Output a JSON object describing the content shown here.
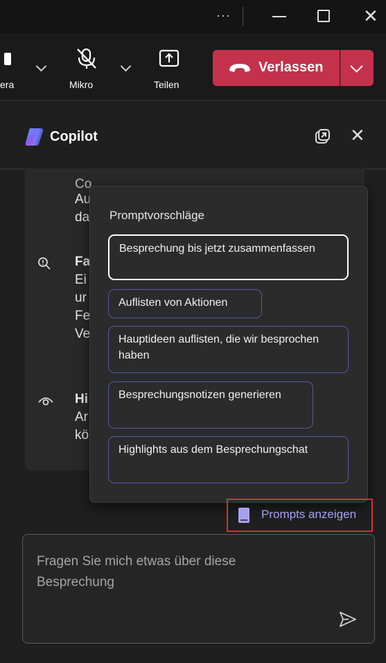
{
  "titlebar": {
    "more_glyph": "···",
    "close_glyph": "✕"
  },
  "toolbar": {
    "camera_label": "era",
    "mic_label": "Mikro",
    "share_label": "Teilen",
    "leave_label": "Verlassen"
  },
  "copilot": {
    "title": "Copilot",
    "close_glyph": "✕"
  },
  "background_card": {
    "line1": "Co",
    "line2": "Au",
    "line3": "da",
    "item2_title": "Fa",
    "item2_lines": [
      "Ei",
      "ur",
      "Fe",
      "Ve"
    ],
    "item3_title": "Hi",
    "item3_lines": [
      "Ar",
      "kö"
    ]
  },
  "prompt_suggestions": {
    "heading": "Promptvorschläge",
    "items": [
      "Besprechung bis jetzt zusammenfassen",
      "Auflisten von Aktionen",
      "Hauptideen auflisten, die wir besprochen haben",
      "Besprechungsnotizen generieren",
      "Highlights aus dem Besprechungschat"
    ]
  },
  "prompts_link": {
    "label": "Prompts anzeigen"
  },
  "chat_input": {
    "placeholder": "Fragen Sie mich etwas über diese Besprechung"
  },
  "colors": {
    "accent": "#a8a1f2",
    "leave_red": "#c4314b",
    "highlight_border": "#d13438"
  }
}
